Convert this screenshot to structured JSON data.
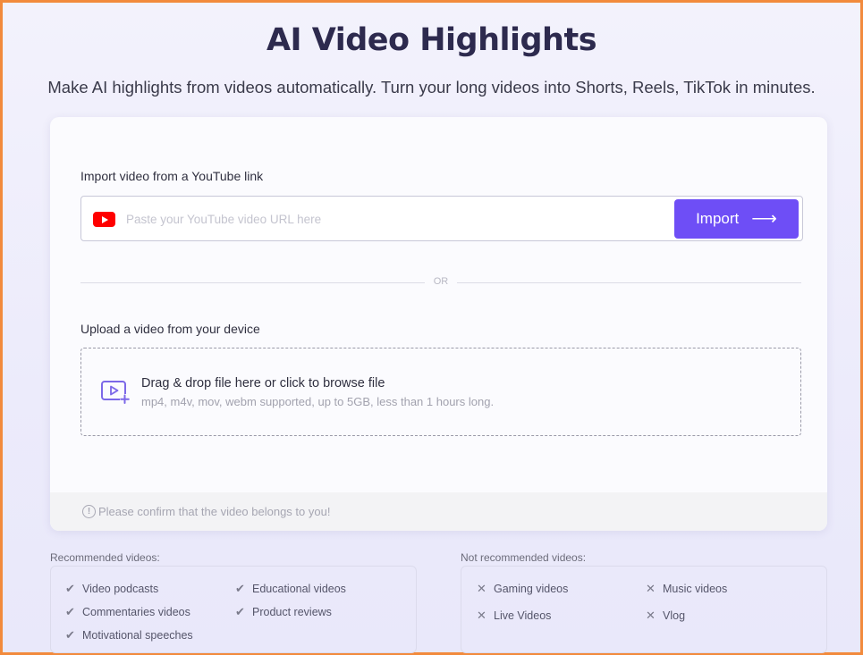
{
  "header": {
    "title": "AI Video Highlights",
    "subtitle": "Make AI highlights from videos automatically. Turn your long videos into Shorts, Reels, TikTok in minutes."
  },
  "youtube": {
    "label": "Import video from a YouTube link",
    "placeholder": "Paste your YouTube video URL here",
    "import_label": "Import",
    "arrow": "⟶"
  },
  "divider": {
    "text": "OR"
  },
  "upload": {
    "label": "Upload a video from your device",
    "main_text": "Drag & drop file here or click to browse file",
    "sub_text": "mp4, m4v, mov, webm supported, up to 5GB, less than 1 hours long."
  },
  "confirm": {
    "icon": "!",
    "text": "Please confirm that the video belongs to you!"
  },
  "recommended": {
    "title": "Recommended videos:",
    "mark": "✔",
    "items": [
      "Video podcasts",
      "Educational videos",
      "Commentaries videos",
      "Product reviews",
      "Motivational speeches"
    ]
  },
  "not_recommended": {
    "title": "Not recommended videos:",
    "mark": "✕",
    "items": [
      "Gaming videos",
      "Music videos",
      "Live Videos",
      "Vlog"
    ]
  },
  "colors": {
    "accent": "#6e4ef6",
    "youtube_red": "#ff0000",
    "frame_border": "#f28a3c"
  }
}
